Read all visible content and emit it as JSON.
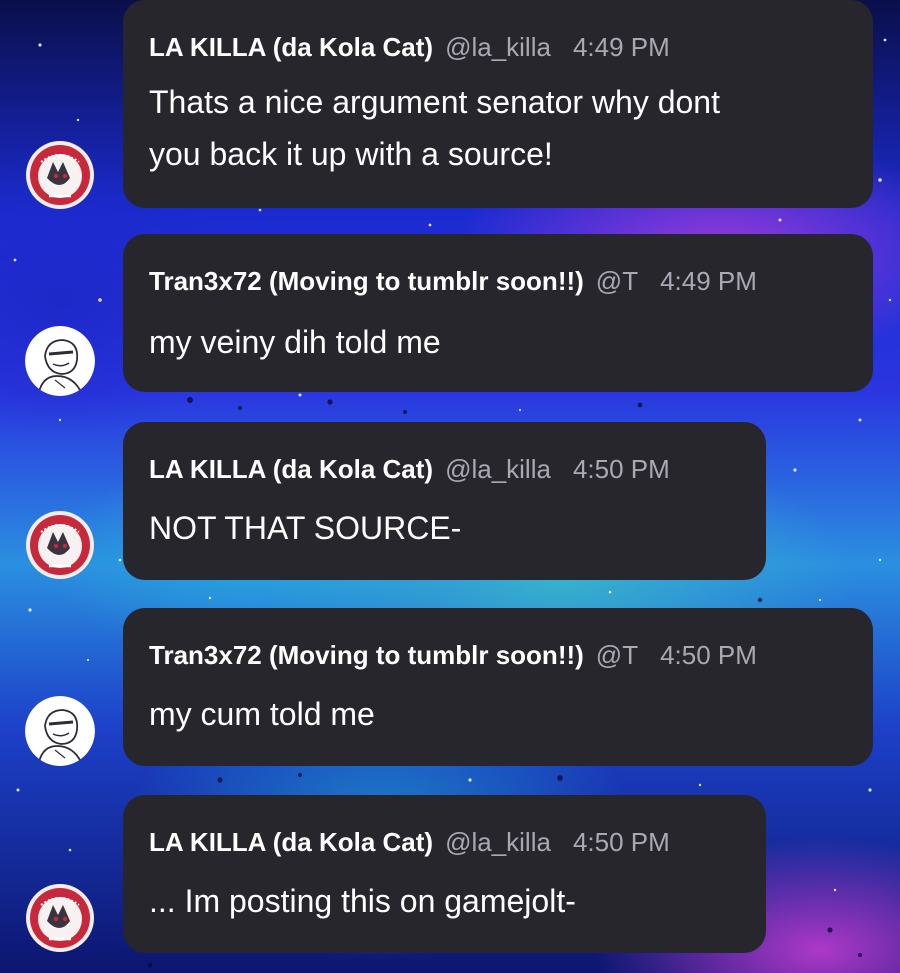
{
  "colors": {
    "bubble_bg": "#28262d",
    "name_text": "#ffffff",
    "meta_text": "#a9a8b3",
    "message_text": "#ffffff"
  },
  "messages": [
    {
      "user": "LA KILLA (da Kola Cat)",
      "handle": "@la_killa",
      "time": "4:49 PM",
      "avatar_icon": "red-badge-cat-avatar-icon",
      "lines": [
        "Thats a nice argument senator why dont",
        "you back it up with a source!"
      ]
    },
    {
      "user": "Tran3x72 (Moving to tumblr soon!!)",
      "handle": "@T",
      "time": "4:49 PM",
      "avatar_icon": "sketch-character-avatar-icon",
      "lines": [
        "my veiny dih told me"
      ]
    },
    {
      "user": "LA KILLA (da Kola Cat)",
      "handle": "@la_killa",
      "time": "4:50 PM",
      "avatar_icon": "red-badge-cat-avatar-icon",
      "lines": [
        "NOT THAT SOURCE-"
      ]
    },
    {
      "user": "Tran3x72 (Moving to tumblr soon!!)",
      "handle": "@T",
      "time": "4:50 PM",
      "avatar_icon": "sketch-character-avatar-icon",
      "lines": [
        "my cum told me"
      ]
    },
    {
      "user": "LA KILLA (da Kola Cat)",
      "handle": "@la_killa",
      "time": "4:50 PM",
      "avatar_icon": "red-badge-cat-avatar-icon",
      "lines": [
        "... Im posting this on gamejolt-"
      ]
    }
  ]
}
